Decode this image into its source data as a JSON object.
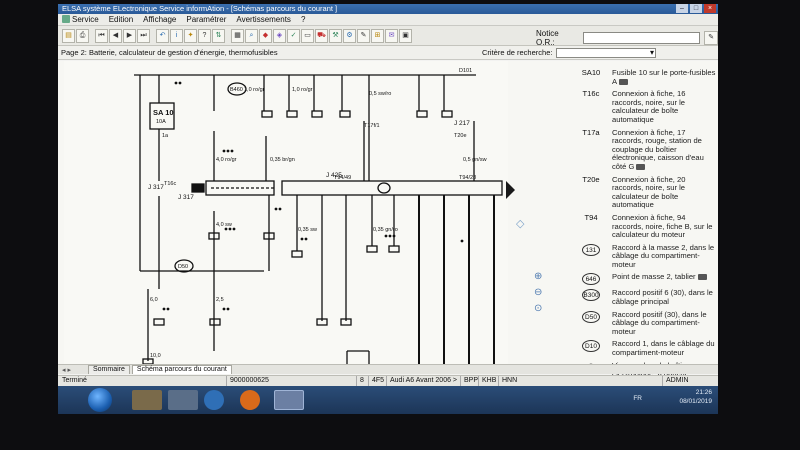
{
  "window": {
    "title": "ELSA système ELectronique Service informAtion - [Schémas parcours du courant ]"
  },
  "menu": {
    "items": [
      "Service",
      "Edition",
      "Affichage",
      "Paramétrer",
      "Avertissements",
      "?"
    ]
  },
  "toolbar": {
    "notice_label": "Notice O.R.:"
  },
  "page": {
    "title": "Page 2: Batterie, calculateur de gestion d'énergie, thermofusibles",
    "search_label": "Critère de recherche:"
  },
  "diagram": {
    "labels": {
      "d101": "D101",
      "b460": "B460",
      "sa_box": "SA 10",
      "sa_amp": "10A",
      "sa1": "1a",
      "j317": "J 317",
      "j317b": "J 317",
      "j217": "J 217",
      "j217b": "J 217",
      "j425": "J 425",
      "t94_49": "T94/49",
      "t94_28": "T94/28",
      "t17f": "T17f/1",
      "t20e": "T20e",
      "t16c": "T16c",
      "d50": "D50",
      "w1": "1,0 ro/gr",
      "w2": "1,0 ro/gr",
      "w3": "0,5 sw/ro",
      "w4": "4,0 ro/gr",
      "w5": "6,0",
      "w6": "2,5",
      "w7": "10,0",
      "w8": "4,0 sw",
      "w9": "0,35 br/gn",
      "w10": "0,5 gn/sw",
      "w11": "0,35 sw",
      "w12": "0,35 gn/ro"
    }
  },
  "legend": [
    {
      "code": "SA10",
      "circle": false,
      "desc": "Fusible 10 sur le porte-fusibles A",
      "cam": true
    },
    {
      "code": "T16c",
      "circle": false,
      "desc": "Connexion à fiche, 16 raccords, noire, sur le calculateur de boîte automatique",
      "cam": false
    },
    {
      "code": "T17a",
      "circle": false,
      "desc": "Connexion à fiche, 17 raccords, rouge, station de couplage du boîtier électronique, caisson d'eau côté G",
      "cam": true
    },
    {
      "code": "T20e",
      "circle": false,
      "desc": "Connexion à fiche, 20 raccords, noire, sur le calculateur de boîte automatique",
      "cam": false
    },
    {
      "code": "T94",
      "circle": false,
      "desc": "Connexion à fiche, 94 raccords, noire, fiche B, sur le calculateur du moteur",
      "cam": false
    },
    {
      "code": "131",
      "circle": true,
      "desc": "Raccord à la masse 2, dans le câblage du compartiment-moteur",
      "cam": false
    },
    {
      "code": "646",
      "circle": true,
      "desc": "Point de masse 2, tablier",
      "cam": true
    },
    {
      "code": "B300",
      "circle": true,
      "desc": "Raccord positif 6 (30), dans le câblage principal",
      "cam": false
    },
    {
      "code": "D50",
      "circle": true,
      "desc": "Raccord positif (30), dans le câblage du compartiment-moteur",
      "cam": false
    },
    {
      "code": "D10",
      "circle": true,
      "desc": "Raccord 1, dans le câblage du compartiment-moteur",
      "cam": false
    },
    {
      "code": "*",
      "circle": false,
      "desc": "Vissage dans le boîtier électronique, à gauche",
      "cam": false
    }
  ],
  "tabs": [
    {
      "label": "Sommaire",
      "active": false
    },
    {
      "label": "Schéma parcours du courant",
      "active": true
    }
  ],
  "status": {
    "left": "Terminé",
    "order": "9000000625",
    "page_num": "8",
    "engine": "4F5",
    "model": "Audi A6 Avant 2006 >",
    "code1": "BPP",
    "code2": "KHB",
    "code3": "HNN",
    "user": "ADMIN"
  },
  "taskbar": {
    "language": "FR",
    "time": "21:26",
    "date": "08/01/2019"
  }
}
